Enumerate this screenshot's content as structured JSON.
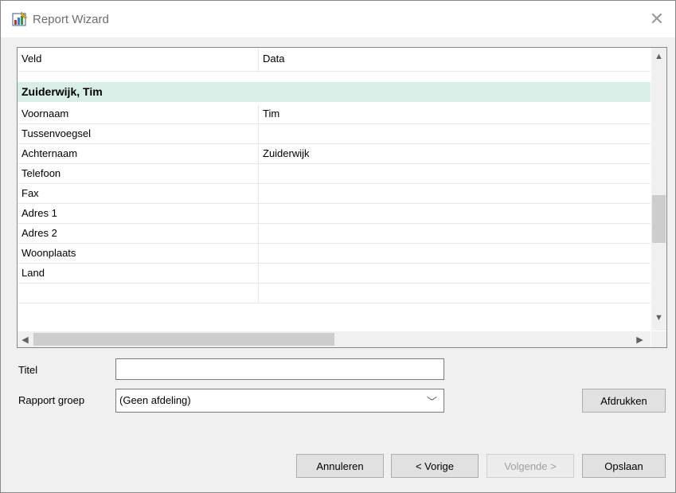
{
  "window": {
    "title": "Report Wizard"
  },
  "grid": {
    "columns": [
      "Veld",
      "Data"
    ],
    "group_label": "Zuiderwijk, Tim",
    "rows": [
      {
        "field": "Voornaam",
        "value": "Tim"
      },
      {
        "field": "Tussenvoegsel",
        "value": ""
      },
      {
        "field": "Achternaam",
        "value": "Zuiderwijk"
      },
      {
        "field": "Telefoon",
        "value": ""
      },
      {
        "field": "Fax",
        "value": ""
      },
      {
        "field": "Adres 1",
        "value": ""
      },
      {
        "field": "Adres 2",
        "value": ""
      },
      {
        "field": "Woonplaats",
        "value": ""
      },
      {
        "field": "Land",
        "value": ""
      }
    ]
  },
  "form": {
    "title_label": "Titel",
    "title_value": "",
    "group_label": "Rapport groep",
    "group_value": "(Geen afdeling)"
  },
  "buttons": {
    "print": "Afdrukken",
    "cancel": "Annuleren",
    "previous": "< Vorige",
    "next": "Volgende >",
    "save": "Opslaan"
  },
  "colors": {
    "group_row": "#d8eee7",
    "dialog_bg": "#f0f0f0"
  },
  "icons": [
    "report-wizard-icon",
    "close-icon",
    "scroll-up-icon",
    "scroll-down-icon",
    "scroll-left-icon",
    "scroll-right-icon",
    "chevron-down-icon"
  ]
}
